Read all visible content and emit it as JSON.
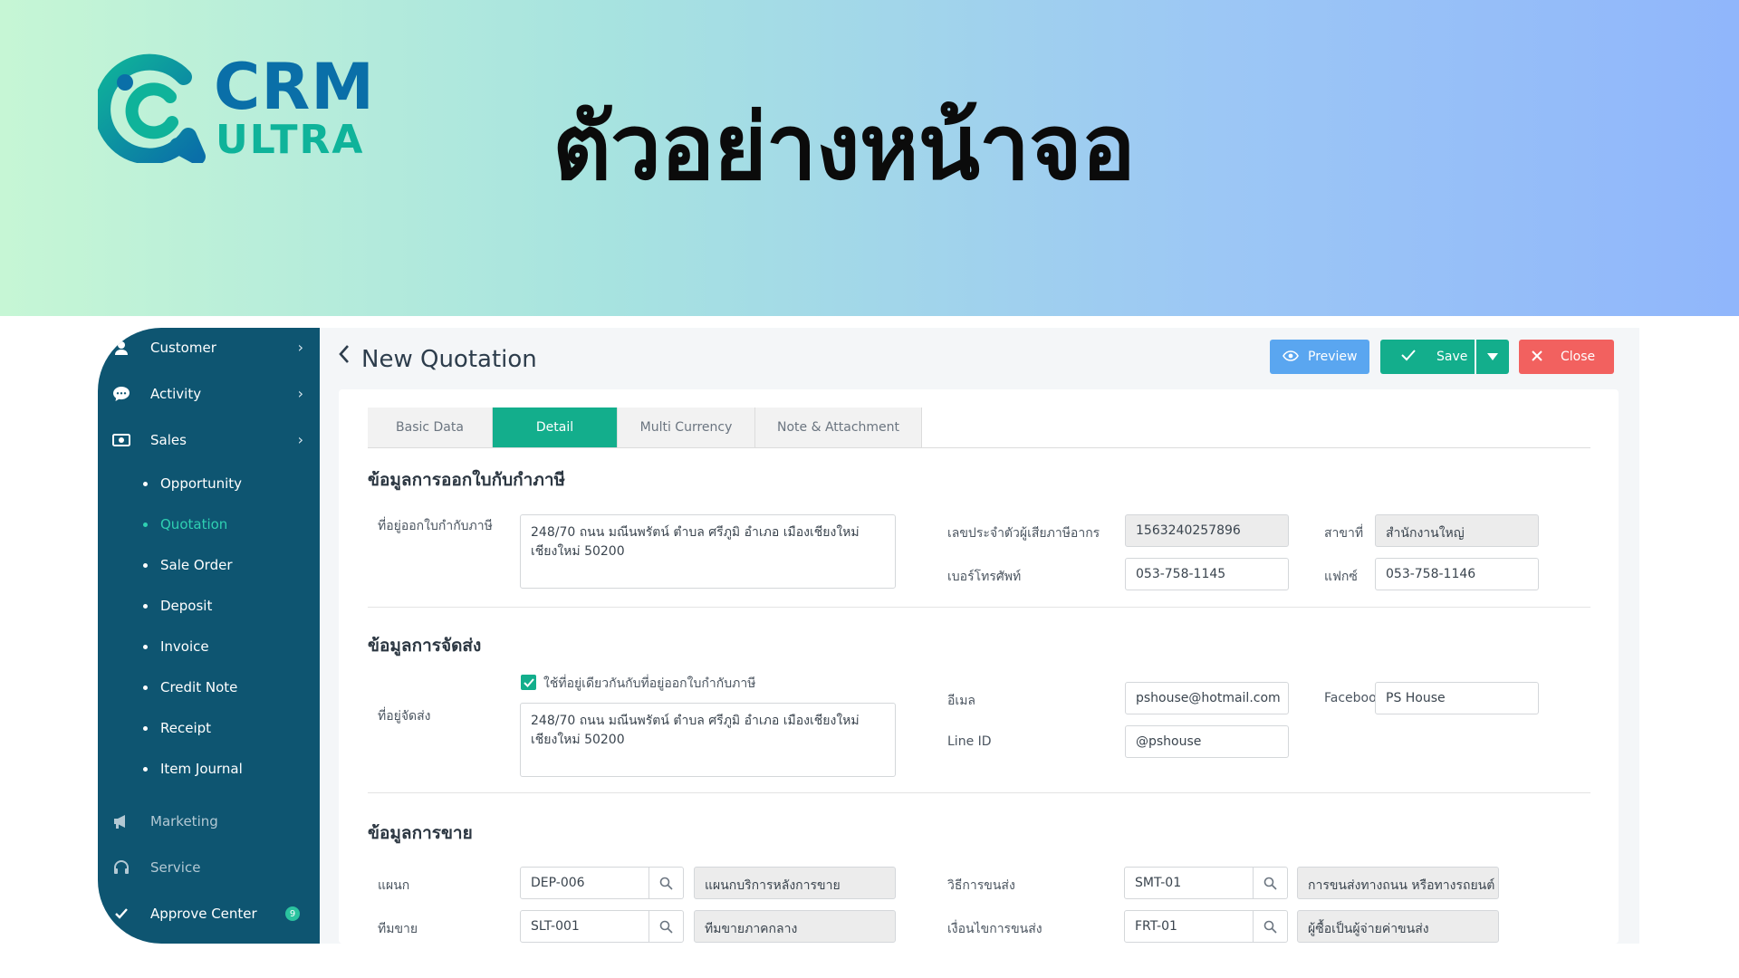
{
  "banner": {
    "logo_crm": "CRM",
    "logo_ultra": "ULTRA",
    "headline": "ตัวอย่างหน้าจอ"
  },
  "sidebar": {
    "items": [
      {
        "label": "Customer",
        "icon": "customer-icon"
      },
      {
        "label": "Activity",
        "icon": "chat-bubble-icon"
      },
      {
        "label": "Sales",
        "icon": "cash-icon"
      }
    ],
    "sales_sub": [
      "Opportunity",
      "Quotation",
      "Sale Order",
      "Deposit",
      "Invoice",
      "Credit Note",
      "Receipt",
      "Item Journal"
    ],
    "active_sub": "Quotation",
    "bottom": [
      {
        "label": "Marketing",
        "icon": "megaphone-icon"
      },
      {
        "label": "Service",
        "icon": "headset-icon"
      },
      {
        "label": "Approve Center",
        "icon": "approve-icon",
        "badge": "9"
      }
    ]
  },
  "header": {
    "title": "New Quotation",
    "preview_label": "Preview",
    "save_label": "Save",
    "close_label": "Close"
  },
  "tabs": [
    "Basic Data",
    "Detail",
    "Multi Currency",
    "Note & Attachment"
  ],
  "active_tab": "Detail",
  "tax": {
    "title": "ข้อมูลการออกใบกับกำภาษี",
    "address_label": "ที่อยู่ออกใบกำกับภาษี",
    "address_line1": "248/70 ถนน มณีนพรัตน์ ตำบล ศรีภูมิ อำเภอ เมืองเชียงใหม่",
    "address_line2": "เชียงใหม่ 50200",
    "taxid_label": "เลขประจำตัวผู้เสียภาษีอากร",
    "taxid_value": "1563240257896",
    "branch_label": "สาขาที่",
    "branch_value": "สำนักงานใหญ่",
    "phone_label": "เบอร์โทรศัพท์",
    "phone_value": "053-758-1145",
    "fax_label": "แฟกซ์",
    "fax_value": "053-758-1146"
  },
  "shipping": {
    "title": "ข้อมูลการจัดส่ง",
    "same_address_label": "ใช้ที่อยู่เดียวกันกับที่อยู่ออกใบกำกับภาษี",
    "same_address_checked": true,
    "address_label": "ที่อยู่จัดส่ง",
    "address_line1": "248/70 ถนน มณีนพรัตน์ ตำบล ศรีภูมิ อำเภอ เมืองเชียงใหม่",
    "address_line2": "เชียงใหม่ 50200",
    "email_label": "อีเมล",
    "email_value": "pshouse@hotmail.com",
    "facebook_label": "Facebook",
    "facebook_value": "PS House",
    "line_label": "Line ID",
    "line_value": "@pshouse"
  },
  "sales": {
    "title": "ข้อมูลการขาย",
    "dept_label": "แผนก",
    "dept_code": "DEP-006",
    "dept_name": "แผนกบริการหลังการขาย",
    "team_label": "ทีมขาย",
    "team_code": "SLT-001",
    "team_name": "ทีมขายภาคกลาง",
    "ship_method_label": "วิธีการขนส่ง",
    "ship_method_code": "SMT-01",
    "ship_method_name": "การขนส่งทางถนน หรือทางรถยนต์",
    "ship_cond_label": "เงื่อนไขการขนส่ง",
    "ship_cond_code": "FRT-01",
    "ship_cond_name": "ผู้ซื้อเป็นผู้จ่ายค่าขนส่ง"
  },
  "colors": {
    "sidebar": "#0e5571",
    "accent": "#13ae8c",
    "preview": "#5aa6f0",
    "close": "#f2615f",
    "active_sub": "#2fd0b2"
  }
}
